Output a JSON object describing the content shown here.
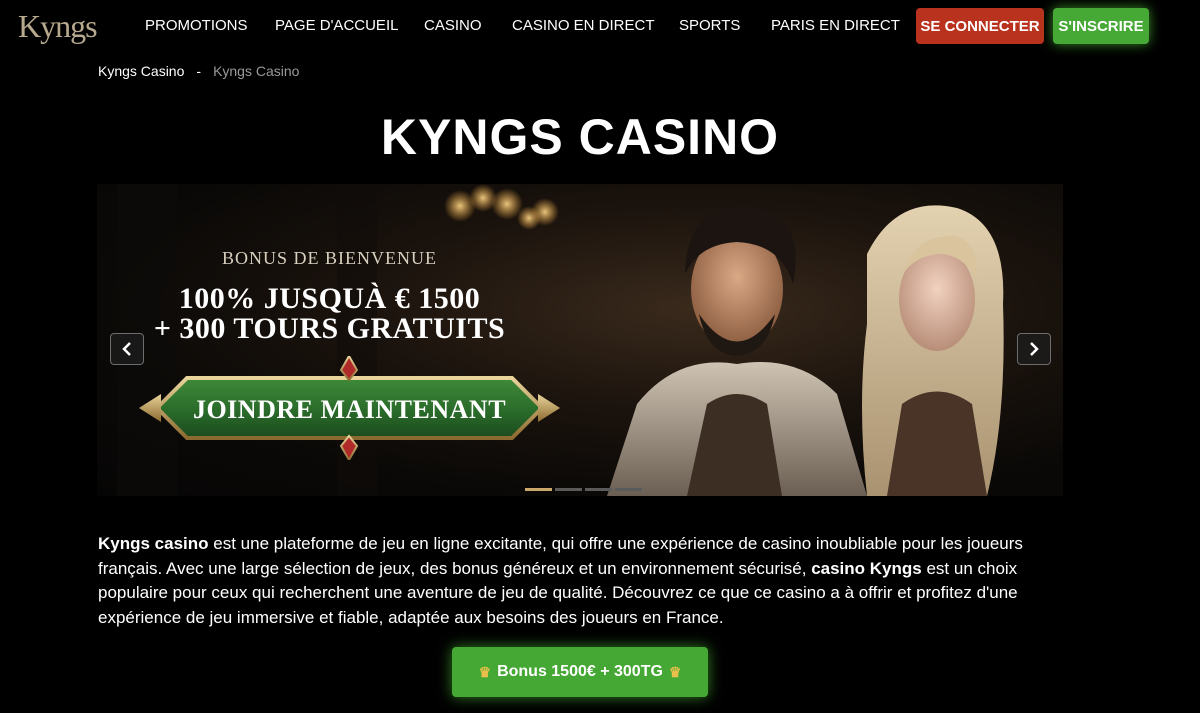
{
  "header": {
    "logo": "Kyngs",
    "nav": [
      "PROMOTIONS",
      "PAGE D'ACCUEIL",
      "CASINO",
      "CASINO EN DIRECT",
      "SPORTS",
      "PARIS EN DIRECT"
    ],
    "login_label": "SE CONNECTER",
    "signup_label": "S'INSCRIRE"
  },
  "breadcrumb": {
    "home": "Kyngs Casino",
    "separator": "-",
    "current": "Kyngs Casino"
  },
  "page_title": "KYNGS CASINO",
  "banner": {
    "subtitle": "BONUS DE BIENVENUE",
    "line1": "100% JUSQUÀ € 1500",
    "line2": "+ 300 TOURS GRATUITS",
    "cta": "JOINDRE MAINTENANT",
    "slides": 4,
    "active_slide": 1
  },
  "intro": {
    "p1_bold": "Kyngs casino",
    "p1_text": " est une plateforme de jeu en ligne excitante, qui offre une expérience de casino inoubliable pour les joueurs français. Avec une large sélection de jeux, des bonus généreux et un environnement sécurisé, ",
    "p1_bold2": "casino Kyngs",
    "p1_text2": " est un choix populaire pour ceux qui recherchent une aventure de jeu de qualité. Découvrez ce que ce casino a à offrir et profitez d'une expérience de jeu immersive et fiable, adaptée aux besoins des joueurs en France."
  },
  "bonus_button": {
    "label": "Bonus 1500€ + 300TG",
    "icon": "crown-icon"
  },
  "colors": {
    "login": "#b8321d",
    "signup": "#47a935",
    "accent_gold": "#c9a86a"
  }
}
